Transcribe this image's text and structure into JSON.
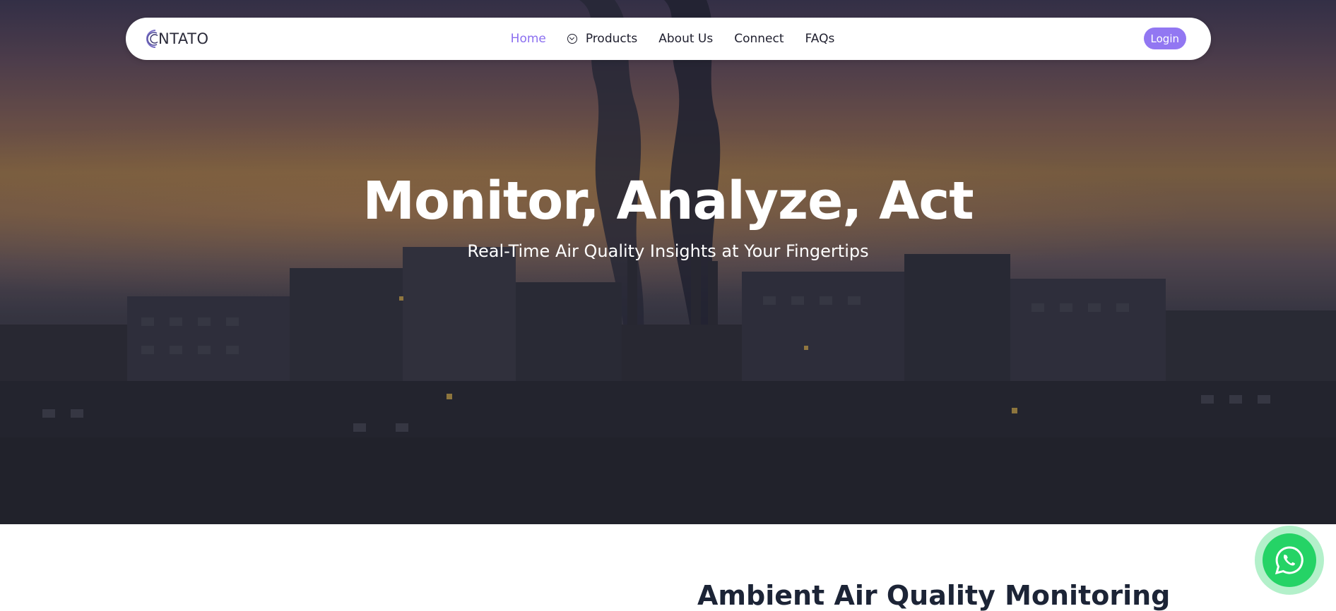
{
  "logo": {
    "text": "NTATO",
    "icon": "logo-arcs-icon"
  },
  "nav": {
    "items": [
      {
        "label": "Home",
        "active": true
      },
      {
        "label": "Products",
        "icon": "chevron-down-circle-icon"
      },
      {
        "label": "About Us"
      },
      {
        "label": "Connect"
      },
      {
        "label": "FAQs"
      }
    ],
    "login_label": "Login"
  },
  "hero": {
    "title": "Monitor, Analyze, Act",
    "subtitle": "Real-Time Air Quality Insights at Your Fingertips"
  },
  "section": {
    "heading": "Ambient Air Quality Monitoring"
  },
  "floating": {
    "icon": "whatsapp-icon"
  },
  "colors": {
    "accent": "#9277f2",
    "active_link": "#8b6ff0",
    "whatsapp": "#25d366",
    "heading": "#1c2436"
  }
}
